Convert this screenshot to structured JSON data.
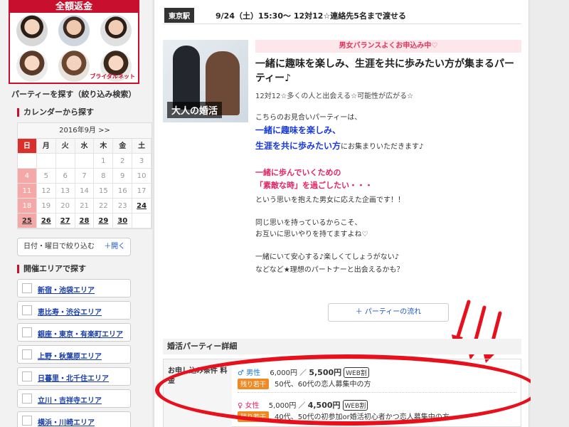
{
  "banner": {
    "heading": "全額返金",
    "brand": "ブライダルネット"
  },
  "sidebar": {
    "search_title": "パーティーを探す（絞り込み検索）",
    "calendar_label": "カレンダーから探す",
    "calendar": {
      "month": "2016年9月 >>",
      "weekdays": [
        "日",
        "月",
        "火",
        "水",
        "木",
        "金",
        "土"
      ],
      "rows": [
        [
          "",
          "",
          "",
          "",
          "1",
          "2",
          "3"
        ],
        [
          "4",
          "5",
          "6",
          "7",
          "8",
          "9",
          "10"
        ],
        [
          "11",
          "12",
          "13",
          "14",
          "15",
          "16",
          "17"
        ],
        [
          "18",
          "19",
          "20",
          "21",
          "22",
          "23",
          "24"
        ],
        [
          "25",
          "26",
          "27",
          "28",
          "29",
          "30",
          ""
        ]
      ]
    },
    "filter_label": "日付・曜日で絞り込む",
    "filter_open": "＋開く",
    "area_label": "開催エリアで探す",
    "areas": [
      "新宿・池袋エリア",
      "恵比寿・渋谷エリア",
      "銀座・東京・有楽町エリア",
      "上野・秋葉原エリア",
      "日暮里・北千住エリア",
      "立川・吉祥寺エリア",
      "横浜・川崎エリア"
    ]
  },
  "event": {
    "station": "東京駅",
    "datetime": "9/24（土）15:30〜 12対12☆連絡先5名まで渡せる",
    "photo_caption": "大人の婚活",
    "tag": "男女バランスよくお申込み中♡",
    "title": "一緒に趣味を楽しみ、生涯を共に歩みたい方が集まるパーティー♪",
    "subtitle": "12対12☆多くの人と出会える☆可能性が広がる☆",
    "desc1": "こちらのお見合いパーティーは、",
    "desc_blue1": "一緒に趣味を楽しみ、",
    "desc_blue2": "生涯を共に歩みたい方",
    "desc_blue2_tail": "にお集まりいただきます♪",
    "desc_pink1": "一緒に歩んでいくための",
    "desc_pink2": "「素敵な時」を過ごしたい・・・",
    "desc2": "という思いを抱えた男女に応えた企画です！！",
    "desc3": "同じ思いを持っているからこそ、",
    "desc4": "お互いに思いやりを持てますよね♡",
    "desc5": "一緒にいて安心する♪楽しくてしょうがない♪",
    "desc6": "などなど★理想のパートナーと出会えるかも？",
    "flow_button": "＋ パーティーの流れ"
  },
  "details": {
    "heading": "婚活パーティー詳細",
    "row_label": "お申し込み条件 料金",
    "male": {
      "gender": "♂ 男性",
      "regular": "6,000円",
      "web_price": "5,500円",
      "web_tag": "WEB割",
      "remain": "残り若干",
      "condition": "50代、60代の恋人募集中の方"
    },
    "female": {
      "gender": "♀ 女性",
      "regular": "5,000円",
      "web_price": "4,500円",
      "web_tag": "WEB割",
      "remain": "残り若干",
      "condition": "40代、50代の初参加or婚活初心者かつ恋人募集中の方"
    }
  },
  "colors": {
    "accent": "#c8102e",
    "annotation": "#e8101c",
    "link": "#1a3ea8"
  }
}
